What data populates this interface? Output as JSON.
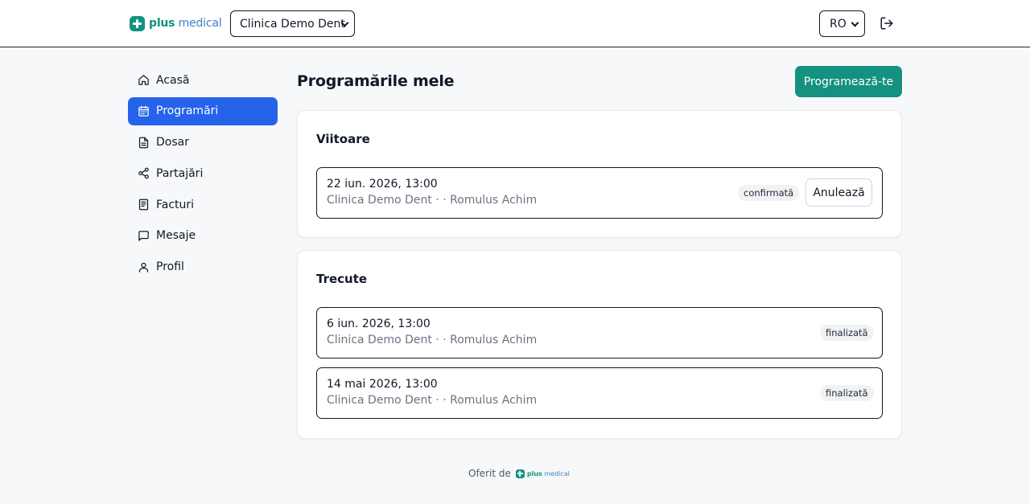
{
  "brand": {
    "name_bold": "plus",
    "name_light": "medical"
  },
  "header": {
    "clinic_selected": "Clinica Demo Dent",
    "language_selected": "RO",
    "logout_icon": "logout-icon"
  },
  "sidebar": {
    "items": [
      {
        "label": "Acasă",
        "icon": "home-icon",
        "active": false
      },
      {
        "label": "Programări",
        "icon": "calendar-icon",
        "active": true
      },
      {
        "label": "Dosar",
        "icon": "document-icon",
        "active": false
      },
      {
        "label": "Partajări",
        "icon": "share-icon",
        "active": false
      },
      {
        "label": "Facturi",
        "icon": "invoice-icon",
        "active": false
      },
      {
        "label": "Mesaje",
        "icon": "message-icon",
        "active": false
      },
      {
        "label": "Profil",
        "icon": "user-icon",
        "active": false
      }
    ]
  },
  "main": {
    "title": "Programările mele",
    "book_button": "Programează-te",
    "upcoming": {
      "title": "Viitoare",
      "appointments": [
        {
          "datetime": "22 iun. 2026, 13:00",
          "details": "Clinica Demo Dent · · Romulus Achim",
          "status": "confirmată",
          "cancel_label": "Anulează"
        }
      ]
    },
    "past": {
      "title": "Trecute",
      "appointments": [
        {
          "datetime": "6 iun. 2026, 13:00",
          "details": "Clinica Demo Dent · · Romulus Achim",
          "status": "finalizată"
        },
        {
          "datetime": "14 mai 2026, 13:00",
          "details": "Clinica Demo Dent · · Romulus Achim",
          "status": "finalizată"
        }
      ]
    }
  },
  "footer": {
    "offered_by": "Oferit de"
  },
  "colors": {
    "accent": "#14917f",
    "active_nav": "#2563eb",
    "brand_light": "#3b82c4"
  }
}
